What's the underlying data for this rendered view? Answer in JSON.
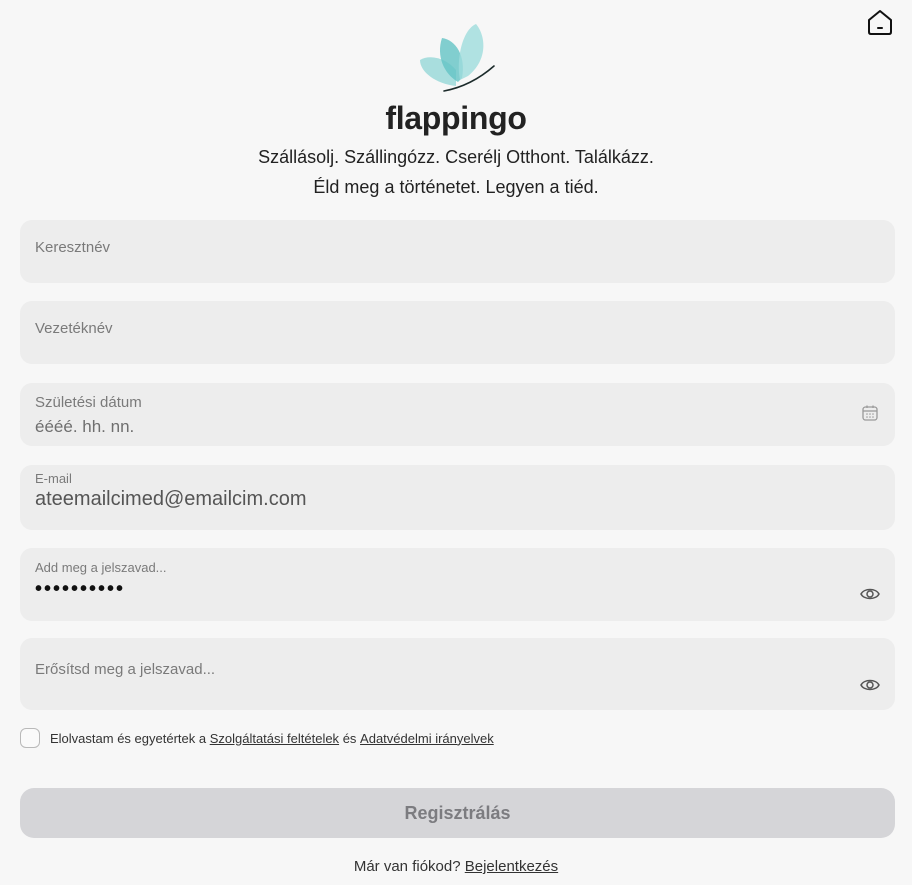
{
  "header": {
    "home_icon": "home-icon",
    "logo_icon": "butterfly-logo",
    "brand": "flappingo",
    "tagline_line1": "Szállásolj. Szállingózz. Cserélj Otthont. Találkázz.",
    "tagline_line2": "Éld meg a történetet. Legyen a tiéd."
  },
  "form": {
    "first_name": {
      "label": "Keresztnév",
      "value": ""
    },
    "last_name": {
      "label": "Vezetéknév",
      "value": ""
    },
    "birth_date": {
      "label": "Születési dátum",
      "placeholder": "éééé. hh. nn.",
      "icon": "calendar-icon"
    },
    "email": {
      "label": "E-mail",
      "value": "ateemailcimed@emailcim.com"
    },
    "password": {
      "label": "Add meg a jelszavad...",
      "value": "••••••••••",
      "icon": "eye-icon"
    },
    "confirm_password": {
      "label": "Erősítsd meg a jelszavad...",
      "value": "",
      "icon": "eye-icon"
    }
  },
  "terms": {
    "checked": false,
    "prefix": "Elolvastam és egyetértek a",
    "terms_link": "Szolgáltatási feltételek",
    "and": "és",
    "privacy_link": "Adatvédelmi irányelvek"
  },
  "actions": {
    "register_label": "Regisztrálás",
    "login_prompt": "Már van fiókod?",
    "login_link": "Bejelentkezés"
  },
  "colors": {
    "background": "#f7f7f7",
    "field": "#ededed",
    "button_disabled": "#d5d5d8",
    "logo_teal": "#6fc9c9"
  }
}
